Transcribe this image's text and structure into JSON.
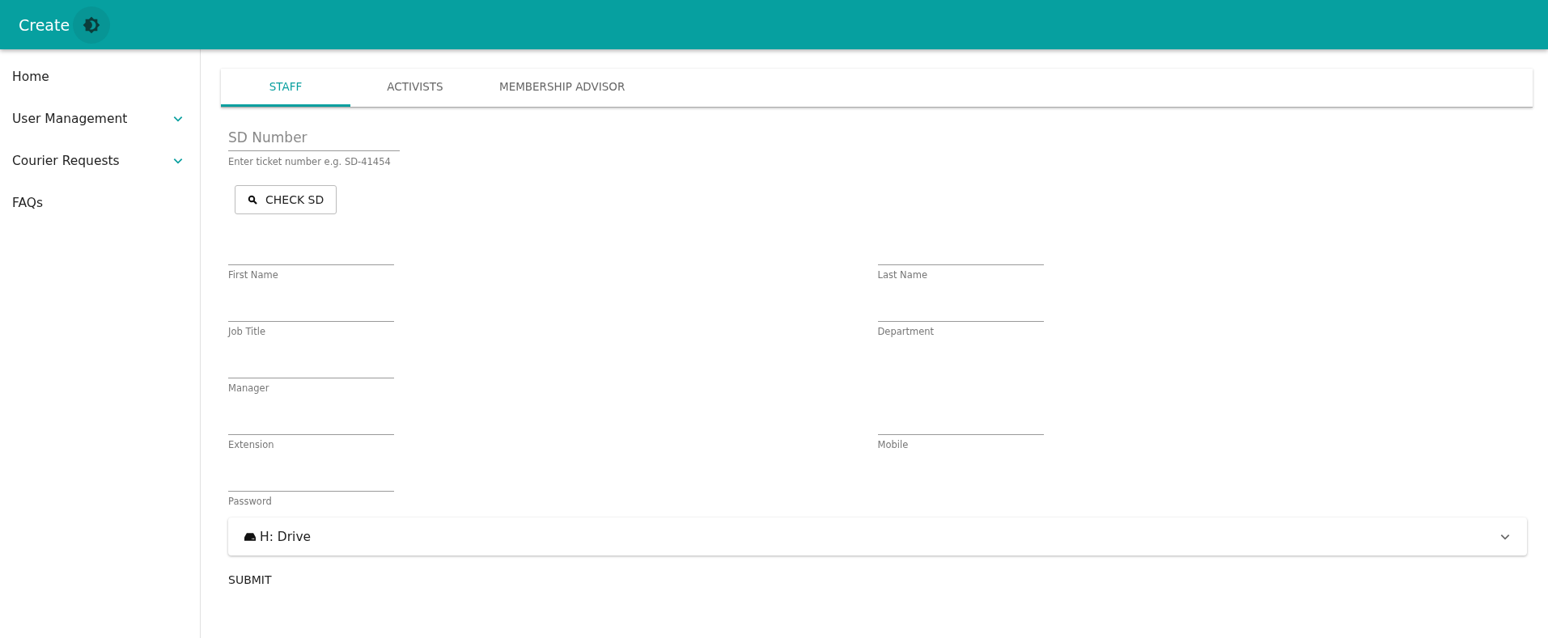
{
  "app_bar": {
    "title": "Create"
  },
  "sidebar": {
    "items": [
      {
        "label": "Home",
        "expandable": false
      },
      {
        "label": "User Management",
        "expandable": true
      },
      {
        "label": "Courier Requests",
        "expandable": true
      },
      {
        "label": "FAQs",
        "expandable": false
      }
    ]
  },
  "tabs": [
    {
      "label": "STAFF",
      "selected": true
    },
    {
      "label": "ACTIVISTS",
      "selected": false
    },
    {
      "label": "MEMBERSHIP ADVISOR",
      "selected": false
    }
  ],
  "sd_field": {
    "placeholder": "SD Number",
    "helper": "Enter ticket number e.g. SD-41454"
  },
  "check_button": {
    "label": "CHECK SD"
  },
  "field_rows": [
    {
      "left": {
        "label": "First Name"
      },
      "right": {
        "label": "Last Name"
      }
    },
    {
      "left": {
        "label": "Job Title"
      },
      "right": {
        "label": "Department"
      }
    },
    {
      "left": {
        "label": "Manager"
      }
    },
    {
      "left": {
        "label": "Extension"
      },
      "right": {
        "label": "Mobile"
      }
    },
    {
      "left": {
        "label": "Password"
      }
    }
  ],
  "drive_panel": {
    "title": "H: Drive",
    "expanded": false
  },
  "submit_button": {
    "label": "SUBMIT"
  }
}
